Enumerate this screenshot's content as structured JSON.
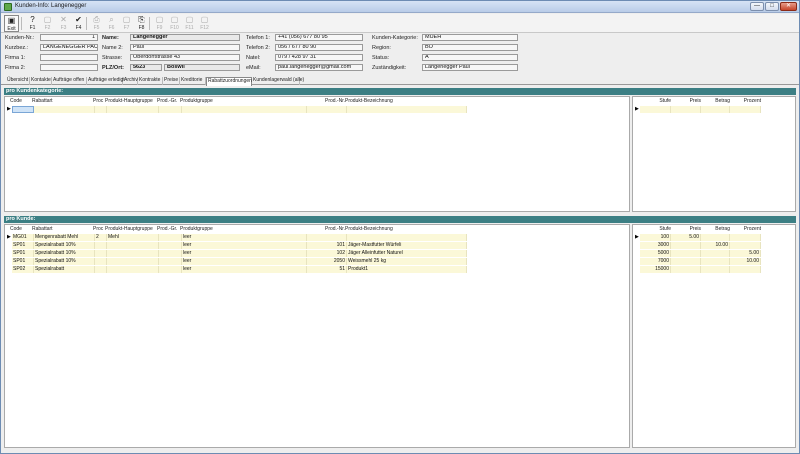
{
  "window": {
    "title": "Kunden-Info: Langenegger",
    "controls": {
      "min": "—",
      "max": "□",
      "close": "✕"
    }
  },
  "toolbar": {
    "buttons": [
      {
        "label": "Exit",
        "icon": "exit-icon"
      },
      {
        "label": "F1",
        "icon": "help-icon"
      },
      {
        "label": "F2",
        "icon": "new-icon"
      },
      {
        "label": "F3",
        "icon": "delete-icon"
      },
      {
        "label": "F4",
        "icon": "save-icon"
      },
      {
        "label": "F5",
        "icon": "print-icon"
      },
      {
        "label": "F6",
        "icon": "search-icon"
      },
      {
        "label": "F7",
        "icon": "blank-icon"
      },
      {
        "label": "F8",
        "icon": "print-preview-icon"
      },
      {
        "label": "F9",
        "icon": "blank-icon"
      },
      {
        "label": "F10",
        "icon": "blank-icon"
      },
      {
        "label": "F11",
        "icon": "blank-icon"
      },
      {
        "label": "F12",
        "icon": "blank-icon"
      }
    ]
  },
  "header": {
    "kunden_nr_label": "Kunden-Nr.:",
    "kunden_nr": "1",
    "kurzbez_label": "Kurzbez.:",
    "kurzbez": "LANGENEGGER PAUL",
    "firma1_label": "Firma 1:",
    "firma1": "",
    "firma2_label": "Firma 2:",
    "firma2": "",
    "name_label": "Name:",
    "name": "Langenegger",
    "name2_label": "Name 2:",
    "name2": "Paul",
    "strasse_label": "Strasse:",
    "strasse": "Oberdorfstrasse 43",
    "plzort_label": "PLZ/Ort:",
    "plz": "5623",
    "ort": "Boswil",
    "tel1_label": "Telefon 1:",
    "tel1": "+41 (056) 677 80 95",
    "tel2_label": "Telefon 2:",
    "tel2": "056 / 677 80 90",
    "natel_label": "Natel:",
    "natel": "079 / 428 97 31",
    "email_label": "eMail:",
    "email": "paul.langenegger@gmail.com",
    "kategorie_label": "Kunden-Kategorie:",
    "kategorie": "MUEH",
    "region_label": "Region:",
    "region": "BO",
    "status_label": "Status:",
    "status": "A",
    "zust_label": "Zuständigkeit:",
    "zust": "Langenegger Paul"
  },
  "tabs": [
    "Übersicht",
    "Kontakte",
    "Aufträge offen",
    "Aufträge erledigt",
    "Archiv",
    "Kontrakte",
    "Preise",
    "Kreditorie",
    "Rabattzuordnungen",
    "Kundenlagerwald (alle)"
  ],
  "section1": {
    "title": "pro Kundenkategorie:",
    "columns": [
      "Code",
      "Rabattart",
      "Proc",
      "Produkt-Hauptgruppe",
      "Prod.-Gr.",
      "Produktgruppe",
      "Prod.-Nr.",
      "Produkt-Bezeichnung"
    ],
    "right_columns": [
      "Stufe",
      "Preis",
      "Betrag",
      "Prozent"
    ]
  },
  "section2": {
    "title": "pro Kunde:",
    "columns": [
      "Code",
      "Rabattart",
      "Proc",
      "Produkt-Hauptgruppe",
      "Prod.-Gr.",
      "Produktgruppe",
      "Prod.-Nr.",
      "Produkt-Bezeichnung"
    ],
    "rows": [
      {
        "code": "MG01",
        "rabattart": "Mengenrabatt Mehl",
        "proc": "2",
        "hauptgruppe": "Mehl",
        "prodgr": "",
        "produktgruppe": "leer",
        "prodnr": "",
        "bez": ""
      },
      {
        "code": "SP01",
        "rabattart": "Spezialrabatt 10%",
        "proc": "",
        "hauptgruppe": "",
        "prodgr": "",
        "produktgruppe": "leer",
        "prodnr": "101",
        "bez": "Jäger-Mastfutter Würfeli"
      },
      {
        "code": "SP01",
        "rabattart": "Spezialrabatt 10%",
        "proc": "",
        "hauptgruppe": "",
        "prodgr": "",
        "produktgruppe": "leer",
        "prodnr": "102",
        "bez": "Jäger Alleinfutter Naturel"
      },
      {
        "code": "SP01",
        "rabattart": "Spezialrabatt 10%",
        "proc": "",
        "hauptgruppe": "",
        "prodgr": "",
        "produktgruppe": "leer",
        "prodnr": "2050",
        "bez": "Weissmehl 25 kg"
      },
      {
        "code": "SP02",
        "rabattart": "Spezialrabatt",
        "proc": "",
        "hauptgruppe": "",
        "prodgr": "",
        "produktgruppe": "leer",
        "prodnr": "51",
        "bez": "Produkt1"
      }
    ],
    "right_columns": [
      "Stufe",
      "Preis",
      "Betrag",
      "Prozent"
    ],
    "right_rows": [
      {
        "stufe": "100",
        "preis": "5.00",
        "betrag": "",
        "prozent": ""
      },
      {
        "stufe": "3000",
        "preis": "",
        "betrag": "10.00",
        "prozent": ""
      },
      {
        "stufe": "5000",
        "preis": "",
        "betrag": "",
        "prozent": "5.00"
      },
      {
        "stufe": "7000",
        "preis": "",
        "betrag": "",
        "prozent": "10.00"
      },
      {
        "stufe": "15000",
        "preis": "",
        "betrag": "",
        "prozent": ""
      }
    ]
  }
}
